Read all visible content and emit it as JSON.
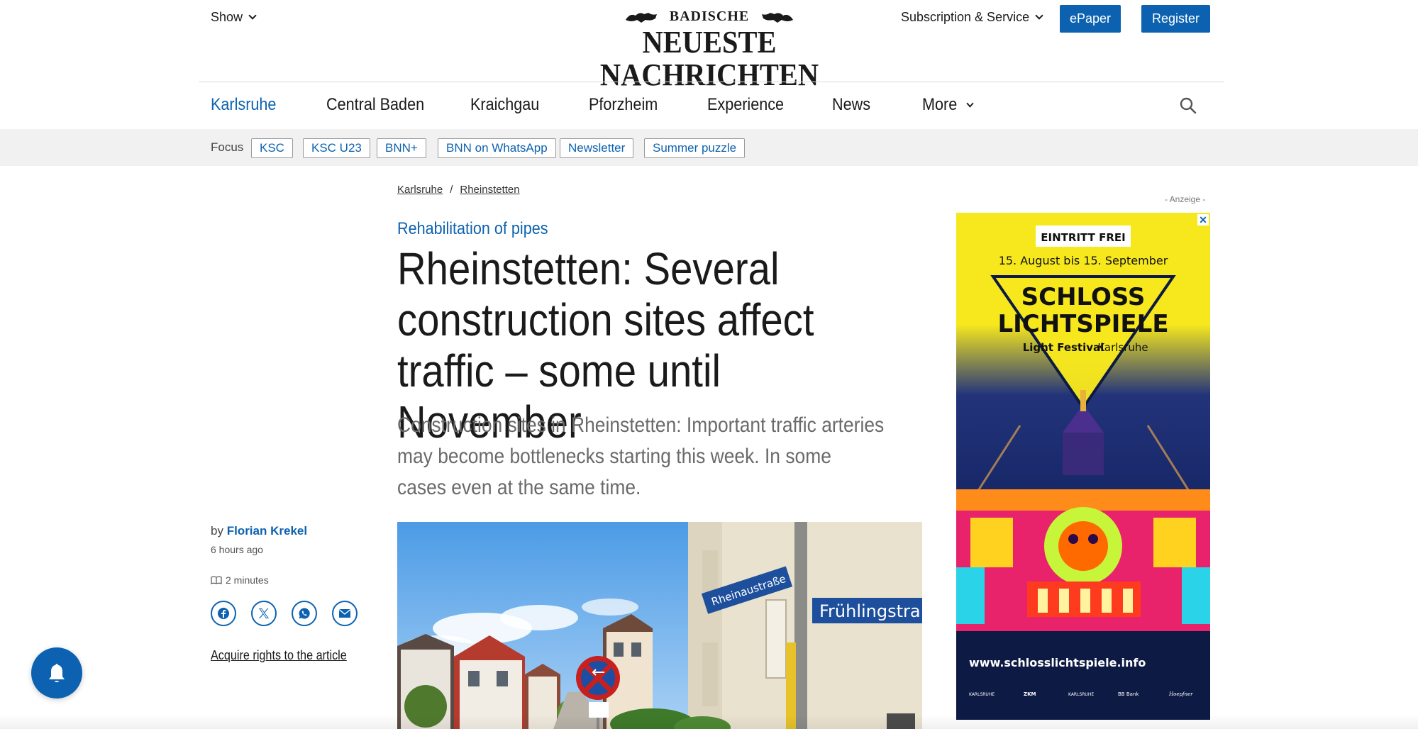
{
  "header": {
    "show_label": "Show",
    "logo_top": "BADISCHE",
    "logo_main": "NEUESTE NACHRICHTEN",
    "subscription_label": "Subscription & Service",
    "epaper_label": "ePaper",
    "register_label": "Register"
  },
  "nav": {
    "items": [
      {
        "label": "Karlsruhe"
      },
      {
        "label": "Central Baden"
      },
      {
        "label": "Kraichgau"
      },
      {
        "label": "Pforzheim"
      },
      {
        "label": "Experience"
      },
      {
        "label": "News"
      },
      {
        "label": "More"
      }
    ]
  },
  "focus": {
    "label": "Focus",
    "chips": [
      "KSC",
      "KSC U23",
      "BNN+",
      "BNN on WhatsApp",
      "Newsletter",
      "Summer puzzle"
    ]
  },
  "breadcrumb": {
    "items": [
      "Karlsruhe",
      "Rheinstetten"
    ],
    "separator": "/"
  },
  "article": {
    "kicker": "Rehabilitation of pipes",
    "headline": "Rheinstetten: Several construction sites affect traffic – some until November",
    "teaser": "Construction sites in Rheinstetten: Important traffic arteries may become bottlenecks starting this week. In some cases even at the same time.",
    "by_prefix": "by",
    "author": "Florian Krekel",
    "time_ago": "6 hours ago",
    "reading_time": "2 minutes",
    "rights_link": "Acquire rights to the article",
    "image_signs": {
      "street_sign_1": "Rheinaustraße",
      "street_sign_2": "Frühlingstra"
    }
  },
  "ad": {
    "label": "- Anzeige -",
    "badge": "EINTRITT FREI",
    "dates": "15. August bis 15. September",
    "title_line1": "SCHLOSS",
    "title_line2": "LICHTSPIELE",
    "subtitle": "Light Festival",
    "subtitle_city": "Karlsruhe",
    "url": "www.schlosslichtspiele.info",
    "sponsors": [
      "KARLSRUHE",
      "ZKM",
      "KARLSRUHE",
      "BB Bank",
      "Hoepfner"
    ]
  },
  "colors": {
    "brand_blue": "#0c62b0",
    "ad_yellow": "#f7e81d",
    "focus_bar": "#f1f1f1"
  },
  "icons": {
    "show": "chevron-down-icon",
    "search": "search-icon",
    "facebook": "facebook-icon",
    "x": "x-twitter-icon",
    "whatsapp": "whatsapp-icon",
    "email": "email-icon",
    "bell": "bell-icon",
    "book": "book-icon"
  }
}
